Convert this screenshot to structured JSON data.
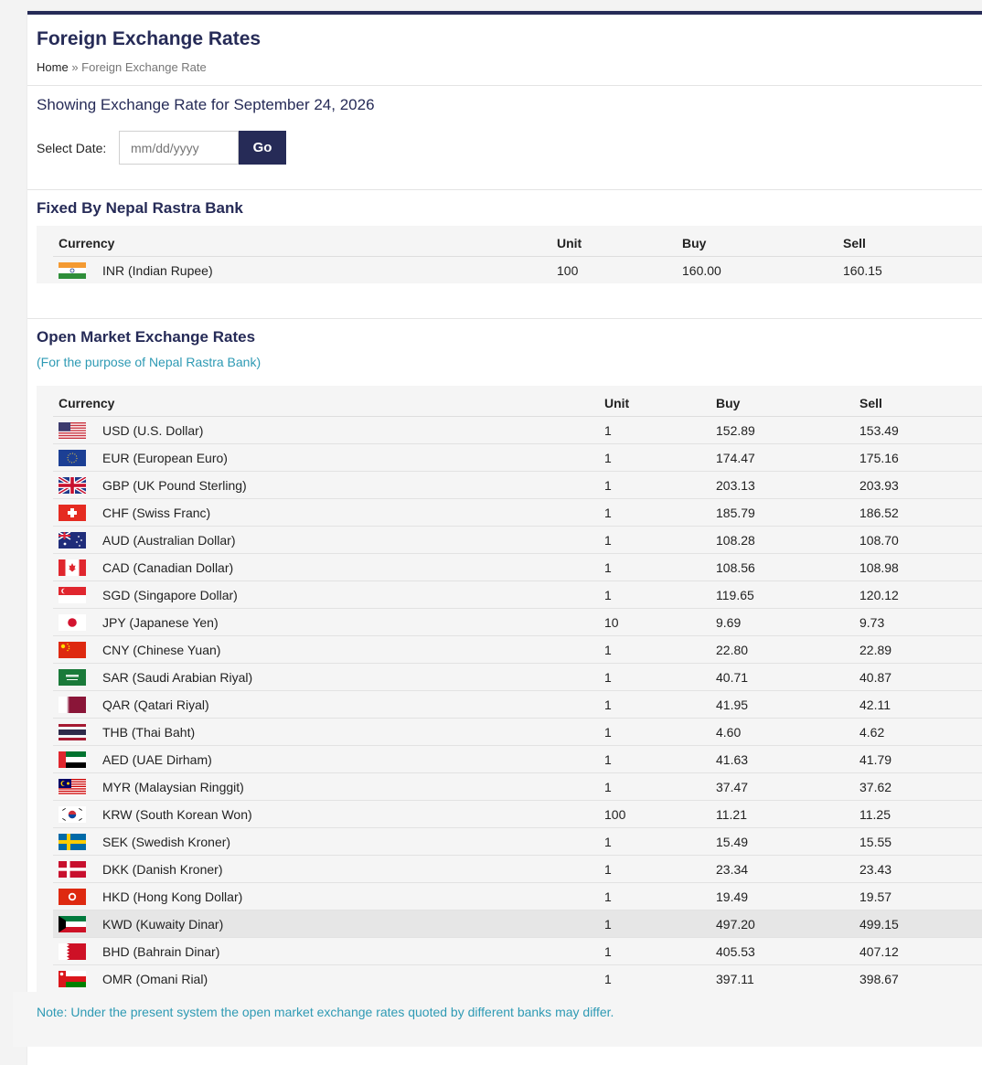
{
  "page": {
    "title": "Foreign Exchange Rates",
    "breadcrumb": {
      "home": "Home",
      "sep": "»",
      "current": "Foreign Exchange Rate"
    }
  },
  "showing": {
    "heading": "Showing Exchange Rate for September 24, 2026",
    "date_label": "Select Date:",
    "date_placeholder": "mm/dd/yyyy",
    "go_label": "Go"
  },
  "fixed": {
    "title": "Fixed By Nepal Rastra Bank",
    "headers": [
      "Currency",
      "Unit",
      "Buy",
      "Sell"
    ],
    "rows": [
      {
        "flag": "in-flag-icon",
        "name": "INR (Indian Rupee)",
        "unit": "100",
        "buy": "160.00",
        "sell": "160.15"
      }
    ]
  },
  "open": {
    "title": "Open Market Exchange Rates",
    "subtitle": "(For the purpose of Nepal Rastra Bank)",
    "headers": [
      "Currency",
      "Unit",
      "Buy",
      "Sell"
    ],
    "rows": [
      {
        "flag": "us-flag-icon",
        "name": "USD (U.S. Dollar)",
        "unit": "1",
        "buy": "152.89",
        "sell": "153.49"
      },
      {
        "flag": "eu-flag-icon",
        "name": "EUR (European Euro)",
        "unit": "1",
        "buy": "174.47",
        "sell": "175.16"
      },
      {
        "flag": "gb-flag-icon",
        "name": "GBP (UK Pound Sterling)",
        "unit": "1",
        "buy": "203.13",
        "sell": "203.93"
      },
      {
        "flag": "ch-flag-icon",
        "name": "CHF (Swiss Franc)",
        "unit": "1",
        "buy": "185.79",
        "sell": "186.52"
      },
      {
        "flag": "au-flag-icon",
        "name": "AUD (Australian Dollar)",
        "unit": "1",
        "buy": "108.28",
        "sell": "108.70"
      },
      {
        "flag": "ca-flag-icon",
        "name": "CAD (Canadian Dollar)",
        "unit": "1",
        "buy": "108.56",
        "sell": "108.98"
      },
      {
        "flag": "sg-flag-icon",
        "name": "SGD (Singapore Dollar)",
        "unit": "1",
        "buy": "119.65",
        "sell": "120.12"
      },
      {
        "flag": "jp-flag-icon",
        "name": "JPY (Japanese Yen)",
        "unit": "10",
        "buy": "9.69",
        "sell": "9.73"
      },
      {
        "flag": "cn-flag-icon",
        "name": "CNY (Chinese Yuan)",
        "unit": "1",
        "buy": "22.80",
        "sell": "22.89"
      },
      {
        "flag": "sa-flag-icon",
        "name": "SAR (Saudi Arabian Riyal)",
        "unit": "1",
        "buy": "40.71",
        "sell": "40.87"
      },
      {
        "flag": "qa-flag-icon",
        "name": "QAR (Qatari Riyal)",
        "unit": "1",
        "buy": "41.95",
        "sell": "42.11"
      },
      {
        "flag": "th-flag-icon",
        "name": "THB (Thai Baht)",
        "unit": "1",
        "buy": "4.60",
        "sell": "4.62"
      },
      {
        "flag": "ae-flag-icon",
        "name": "AED (UAE Dirham)",
        "unit": "1",
        "buy": "41.63",
        "sell": "41.79"
      },
      {
        "flag": "my-flag-icon",
        "name": "MYR (Malaysian Ringgit)",
        "unit": "1",
        "buy": "37.47",
        "sell": "37.62"
      },
      {
        "flag": "kr-flag-icon",
        "name": "KRW (South Korean Won)",
        "unit": "100",
        "buy": "11.21",
        "sell": "11.25"
      },
      {
        "flag": "se-flag-icon",
        "name": "SEK (Swedish Kroner)",
        "unit": "1",
        "buy": "15.49",
        "sell": "15.55"
      },
      {
        "flag": "dk-flag-icon",
        "name": "DKK (Danish Kroner)",
        "unit": "1",
        "buy": "23.34",
        "sell": "23.43"
      },
      {
        "flag": "hk-flag-icon",
        "name": "HKD (Hong Kong Dollar)",
        "unit": "1",
        "buy": "19.49",
        "sell": "19.57"
      },
      {
        "flag": "kw-flag-icon",
        "name": "KWD (Kuwaity Dinar)",
        "unit": "1",
        "buy": "497.20",
        "sell": "499.15",
        "highlighted": true
      },
      {
        "flag": "bh-flag-icon",
        "name": "BHD (Bahrain Dinar)",
        "unit": "1",
        "buy": "405.53",
        "sell": "407.12"
      },
      {
        "flag": "om-flag-icon",
        "name": "OMR (Omani Rial)",
        "unit": "1",
        "buy": "397.11",
        "sell": "398.67"
      }
    ],
    "note": "Note: Under the present system the open market exchange rates quoted by different banks may differ."
  },
  "colors": {
    "brand": "#262b57",
    "accent": "#2e9ab4",
    "panel": "#f5f5f5"
  }
}
